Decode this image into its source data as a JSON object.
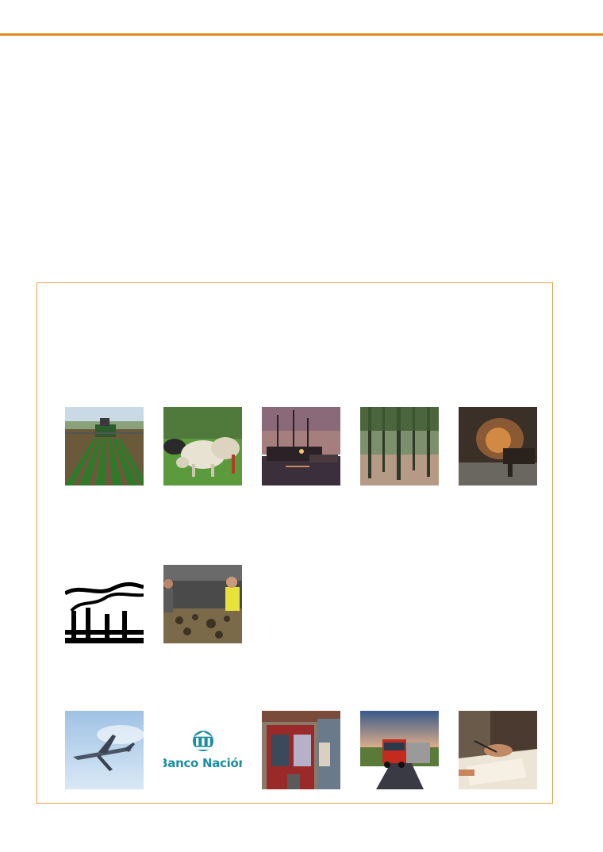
{
  "colors": {
    "accent": "#e38a1c",
    "frame_border": "#e5a04c",
    "bank_teal": "#1b8fa0"
  },
  "tiles": [
    {
      "subject": "tractor-field"
    },
    {
      "subject": "sheep-grazing"
    },
    {
      "subject": "fishing-boats"
    },
    {
      "subject": "pine-forest"
    },
    {
      "subject": "mine-tunnel"
    },
    {
      "subject": "factory-smokestacks"
    },
    {
      "subject": "sorting-workers"
    },
    {
      "subject": "airplane"
    },
    {
      "subject": "bank-logo"
    },
    {
      "subject": "shop-storefront"
    },
    {
      "subject": "red-truck"
    },
    {
      "subject": "document-writing"
    }
  ],
  "bank_logo": {
    "name": "Banco Nación"
  }
}
